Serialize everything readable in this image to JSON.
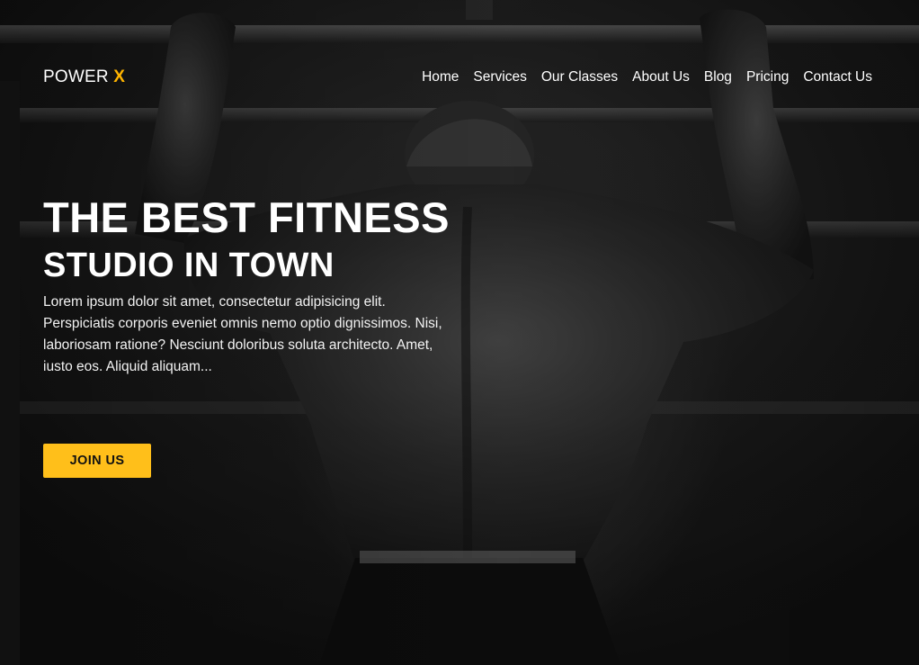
{
  "brand": {
    "name": "POWER",
    "accent": "X",
    "accent_color": "#ffb400"
  },
  "nav": {
    "items": [
      {
        "label": "Home"
      },
      {
        "label": "Services"
      },
      {
        "label": "Our Classes"
      },
      {
        "label": "About Us"
      },
      {
        "label": "Blog"
      },
      {
        "label": "Pricing"
      },
      {
        "label": "Contact Us"
      }
    ]
  },
  "hero": {
    "headline": "THE BEST FITNESS",
    "subheadline": "STUDIO IN TOWN",
    "description": "Lorem ipsum dolor sit amet, consectetur adipisicing elit. Perspiciatis corporis eveniet omnis nemo optio dignissimos. Nisi, laboriosam ratione? Nesciunt doloribus soluta architecto. Amet, iusto eos. Aliquid aliquam...",
    "cta_label": "JOIN US",
    "cta_color": "#ffbf1a"
  }
}
